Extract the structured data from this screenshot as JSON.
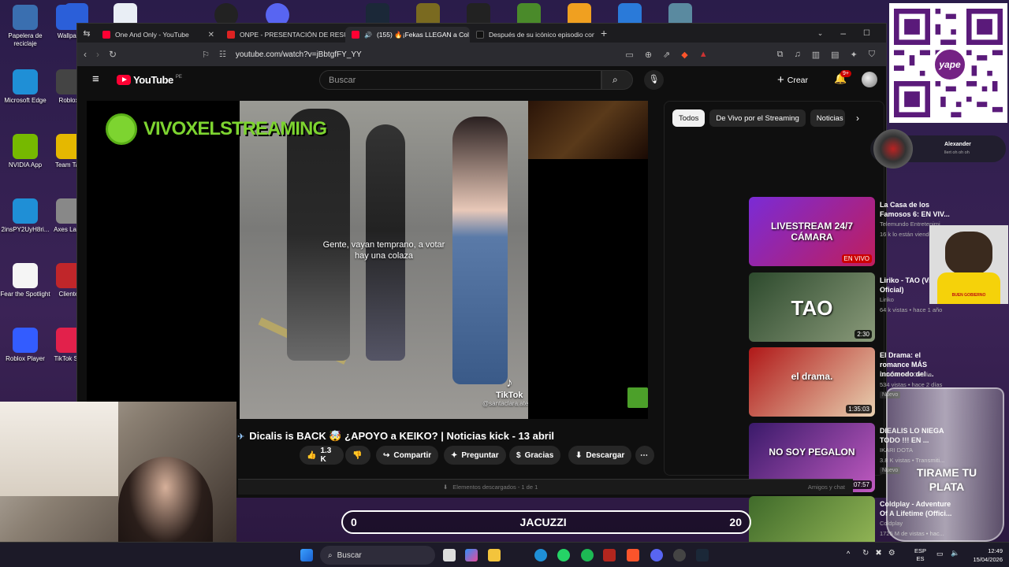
{
  "desktop": {
    "icons": [
      {
        "label": "Papelera de reciclaje",
        "color": "#3a6fb0"
      },
      {
        "label": "Wallpap",
        "color": "#2b5fd9"
      },
      {
        "label": "Microsoft Edge",
        "color": "#1f8fd6"
      },
      {
        "label": "Roblox",
        "color": "#444"
      },
      {
        "label": "NVIDIA App",
        "color": "#76b900"
      },
      {
        "label": "Team Tac",
        "color": "#e5b800"
      },
      {
        "label": "2insPY2UyH8ri...",
        "color": "#1f8fd6"
      },
      {
        "label": "Axes Laun",
        "color": "#888"
      },
      {
        "label": "Fear the Spotlight",
        "color": "#f5f5f5"
      },
      {
        "label": "Cliente",
        "color": "#c0262a"
      },
      {
        "label": "Roblox Player",
        "color": "#335cff"
      },
      {
        "label": "TikTok Stu",
        "color": "#e2214b"
      }
    ]
  },
  "browser": {
    "tabs": [
      {
        "title": "One And Only - YouTube",
        "color": "#ff0033"
      },
      {
        "title": "ONPE - PRESENTACIÓN DE RESULTA",
        "color": "#d22"
      },
      {
        "title": "(155) 🔥¡Fekas LLEGAN a Col",
        "color": "#ff0033"
      },
      {
        "title": "Después de su icónico episodio con",
        "color": "#111"
      }
    ],
    "url": "youtube.com/watch?v=jBbtgfFY_YY"
  },
  "youtube": {
    "logo": "YouTube",
    "region": "PE",
    "search_placeholder": "Buscar",
    "create_label": "Crear",
    "notif_count": "9+",
    "overlay_brand": "VIVOXELSTREAMING",
    "caption": "Gente, vayan temprano, a votar hay una colaza",
    "tiktok_label": "TikTok",
    "tiktok_handle": "@santaclara.ate",
    "video_title": "Dicalis is BACK 🤯 ¿APOYO a KEIKO? | Noticias kick - 13 abril",
    "actions": {
      "likes": "1.3 K",
      "share": "Compartir",
      "ask": "Preguntar",
      "thanks": "Gracias",
      "download": "Descargar"
    },
    "chips": [
      "Todos",
      "De Vivo por el Streaming",
      "Noticias"
    ],
    "recommendations": [
      {
        "title": "La Casa de los Famosos 6: EN VIV...",
        "channel": "Telemundo Entretenimi...",
        "meta": "16 k lo están viendo",
        "badge": "EN VIVO",
        "thumb_text": "LIVESTREAM 24/7 CÁMARA",
        "colors": [
          "#7a2bd6",
          "#c01e5c"
        ]
      },
      {
        "title": "Liriko - TAO (Video Oficial)",
        "channel": "Liriko",
        "meta": "64 k vistas • hace 1 año",
        "duration": "2:30",
        "thumb_text": "TAO",
        "colors": [
          "#2d4a2d",
          "#8a9a7a"
        ]
      },
      {
        "title": "El Drama: el romance MÁS incómodo del ...",
        "channel": "Charlas con Charlie",
        "meta": "534 vistas • hace 2 días",
        "tag": "Nuevo",
        "duration": "1:35:03",
        "thumb_text": "el drama.",
        "colors": [
          "#b01818",
          "#e8d0b0"
        ]
      },
      {
        "title": "DIEALIS LO NIEGA TODO !!! EN ...",
        "channel": "IKARI DOTA",
        "meta": "3.8 K vistas • Transmiti...",
        "tag": "Nuevo",
        "duration": "1:07:57",
        "thumb_text": "NO SOY PEGALON",
        "colors": [
          "#3a1a6a",
          "#c05ac0"
        ]
      },
      {
        "title": "Coldplay - Adventure Of A Lifetime (Offici...",
        "channel": "Coldplay",
        "meta": "1725 M de vistas • hac...",
        "thumb_text": "",
        "colors": [
          "#3f6a2a",
          "#9bbd5a"
        ]
      }
    ],
    "downloads_bar": "Elementos descargados - 1 de 1",
    "friends_bar": "Amigos y chat"
  },
  "overlays": {
    "jacuzzi": {
      "left": "0",
      "label": "JACUZZI",
      "right": "20"
    },
    "glass_text": "TIRAME TU PLATA",
    "chat_user": "Alexander",
    "chat_sub": "llert oh oh oh",
    "qr_brand": "yape",
    "dog_shirt": "BUEN GOBIERNO"
  },
  "taskbar": {
    "search": "Buscar",
    "lang": "ESP",
    "lang2": "ES",
    "time": "12:49",
    "date": "15/04/2026"
  }
}
